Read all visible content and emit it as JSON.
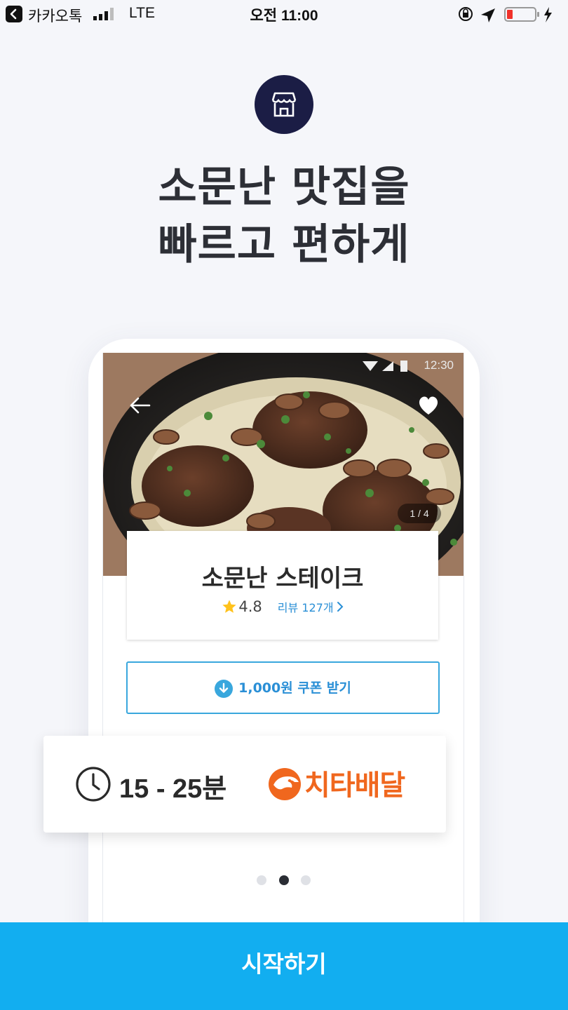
{
  "status_bar": {
    "app_name": "카카오톡",
    "carrier": "LTE",
    "time": "오전 11:00",
    "icons": [
      "back-app-icon",
      "signal-icon",
      "orientation-lock-icon",
      "location-icon",
      "battery-low-icon",
      "charging-bolt-icon"
    ]
  },
  "hero": {
    "icon": "storefront-icon",
    "headline_line1": "소문난 맛집을",
    "headline_line2": "빠르고 편하게"
  },
  "phone_screen": {
    "android_time": "12:30",
    "photo_pager": "1 / 4",
    "restaurant": {
      "name": "소문난 스테이크",
      "rating": "4.8",
      "reviews": "리뷰 127개"
    },
    "coupon_label": "1,000원 쿠폰 받기"
  },
  "delivery": {
    "time_range": "15 - 25분",
    "brand": "치타배달"
  },
  "pager": {
    "count": 3,
    "active_index": 1
  },
  "start_button": "시작하기",
  "colors": {
    "accent": "#12aef0",
    "hero_icon_bg": "#1b1d45",
    "brand_orange": "#f0671e",
    "link_blue": "#2a8fd6"
  }
}
